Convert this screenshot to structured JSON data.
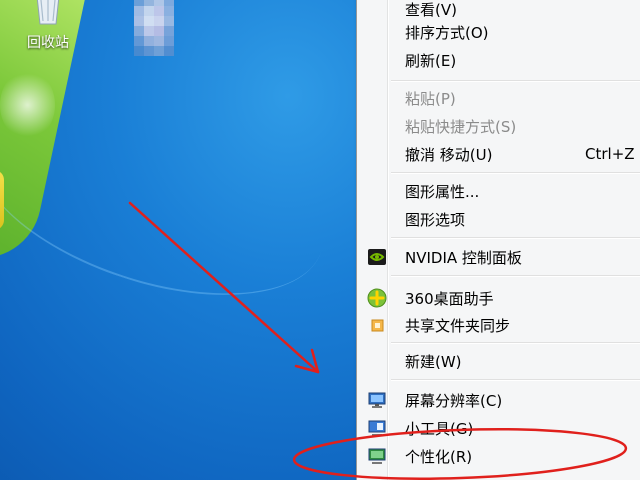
{
  "desktop": {
    "recycle_bin_label": "回收站"
  },
  "context_menu": {
    "items": [
      {
        "label": "查看(V)",
        "enabled": true
      },
      {
        "label": "排序方式(O)",
        "enabled": true
      },
      {
        "label": "刷新(E)",
        "enabled": true
      },
      {
        "label": "粘贴(P)",
        "enabled": false
      },
      {
        "label": "粘贴快捷方式(S)",
        "enabled": false
      },
      {
        "label": "撤消 移动(U)",
        "shortcut": "Ctrl+Z",
        "enabled": true
      },
      {
        "label": "图形属性...",
        "enabled": true
      },
      {
        "label": "图形选项",
        "enabled": true
      },
      {
        "label": "NVIDIA 控制面板",
        "icon": "nvidia-icon",
        "enabled": true
      },
      {
        "label": "360桌面助手",
        "icon": "360-icon",
        "enabled": true
      },
      {
        "label": "共享文件夹同步",
        "icon": "folder-sync-icon",
        "enabled": true
      },
      {
        "label": "新建(W)",
        "enabled": true
      },
      {
        "label": "屏幕分辨率(C)",
        "icon": "screen-resolution-icon",
        "enabled": true
      },
      {
        "label": "小工具(G)",
        "icon": "gadgets-icon",
        "enabled": true
      },
      {
        "label": "个性化(R)",
        "icon": "personalize-icon",
        "enabled": true
      }
    ]
  },
  "colors": {
    "annotation": "#e0201c",
    "menu_background": "#f5f6f7",
    "desktop_blue": "#1a7fd6"
  }
}
